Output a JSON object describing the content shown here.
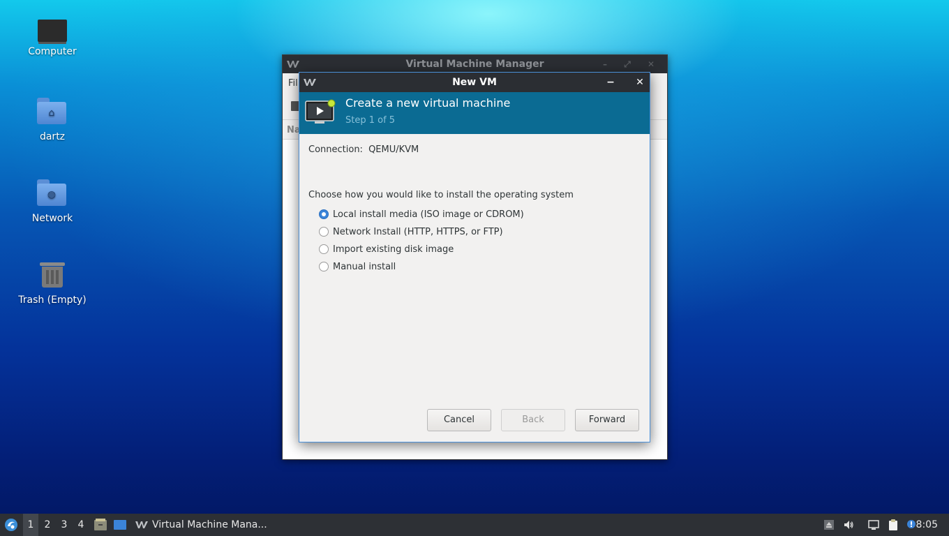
{
  "desktop": {
    "icons": [
      {
        "label": "Computer"
      },
      {
        "label": "dartz"
      },
      {
        "label": "Network"
      },
      {
        "label": "Trash (Empty)"
      }
    ]
  },
  "main_window": {
    "title": "Virtual Machine Manager",
    "menu_partial": "Fil",
    "column_partial": "Na"
  },
  "dialog": {
    "title": "New VM",
    "minimize_glyph": "−",
    "close_glyph": "✕",
    "banner_title": "Create a new virtual machine",
    "banner_step": "Step 1 of 5",
    "connection_label": "Connection:",
    "connection_value": "QEMU/KVM",
    "choose_label": "Choose how you would like to install the operating system",
    "options": [
      {
        "label": "Local install media (ISO image or CDROM)",
        "checked": true
      },
      {
        "label": "Network Install (HTTP, HTTPS, or FTP)",
        "checked": false
      },
      {
        "label": "Import existing disk image",
        "checked": false
      },
      {
        "label": "Manual install",
        "checked": false
      }
    ],
    "buttons": {
      "cancel": "Cancel",
      "back": "Back",
      "forward": "Forward"
    },
    "accent_color": "#0b6b93"
  },
  "taskbar": {
    "workspaces": [
      "1",
      "2",
      "3",
      "4"
    ],
    "active_workspace": "1",
    "task_label": "Virtual Machine Mana...",
    "clock": "8:05"
  }
}
